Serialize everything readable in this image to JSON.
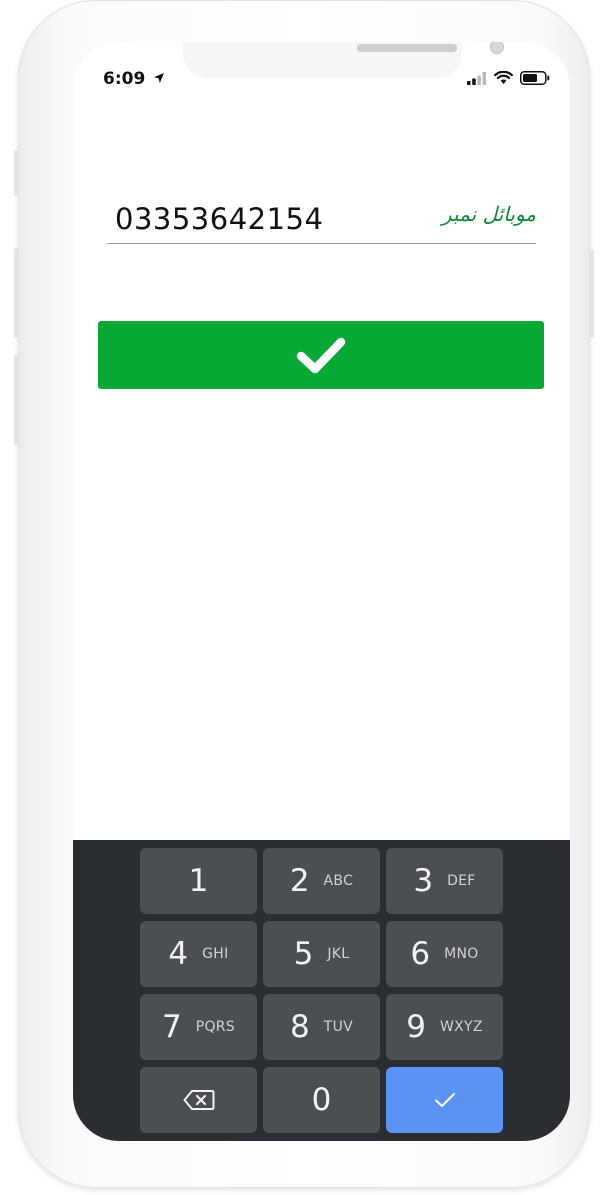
{
  "status_bar": {
    "time": "6:09"
  },
  "form": {
    "mobile_value": "03353642154",
    "mobile_label": "موبائل نمبر"
  },
  "keypad": {
    "keys": [
      {
        "digit": "1",
        "letters": ""
      },
      {
        "digit": "2",
        "letters": "ABC"
      },
      {
        "digit": "3",
        "letters": "DEF"
      },
      {
        "digit": "4",
        "letters": "GHI"
      },
      {
        "digit": "5",
        "letters": "JKL"
      },
      {
        "digit": "6",
        "letters": "MNO"
      },
      {
        "digit": "7",
        "letters": "PQRS"
      },
      {
        "digit": "8",
        "letters": "TUV"
      },
      {
        "digit": "9",
        "letters": "WXYZ"
      },
      {
        "digit": "0",
        "letters": ""
      }
    ]
  },
  "colors": {
    "submit_green": "#05a934",
    "label_green": "#0d8a35",
    "keypad_bg": "#2a2d31",
    "key_bg": "#4b4e52",
    "done_key_blue": "#5a93f4"
  },
  "icons": {
    "location": "location-arrow-icon",
    "signal": "signal-bars-icon",
    "wifi": "wifi-icon",
    "battery": "battery-icon",
    "submit": "checkmark-icon",
    "backspace": "backspace-icon",
    "done": "checkmark-icon"
  }
}
